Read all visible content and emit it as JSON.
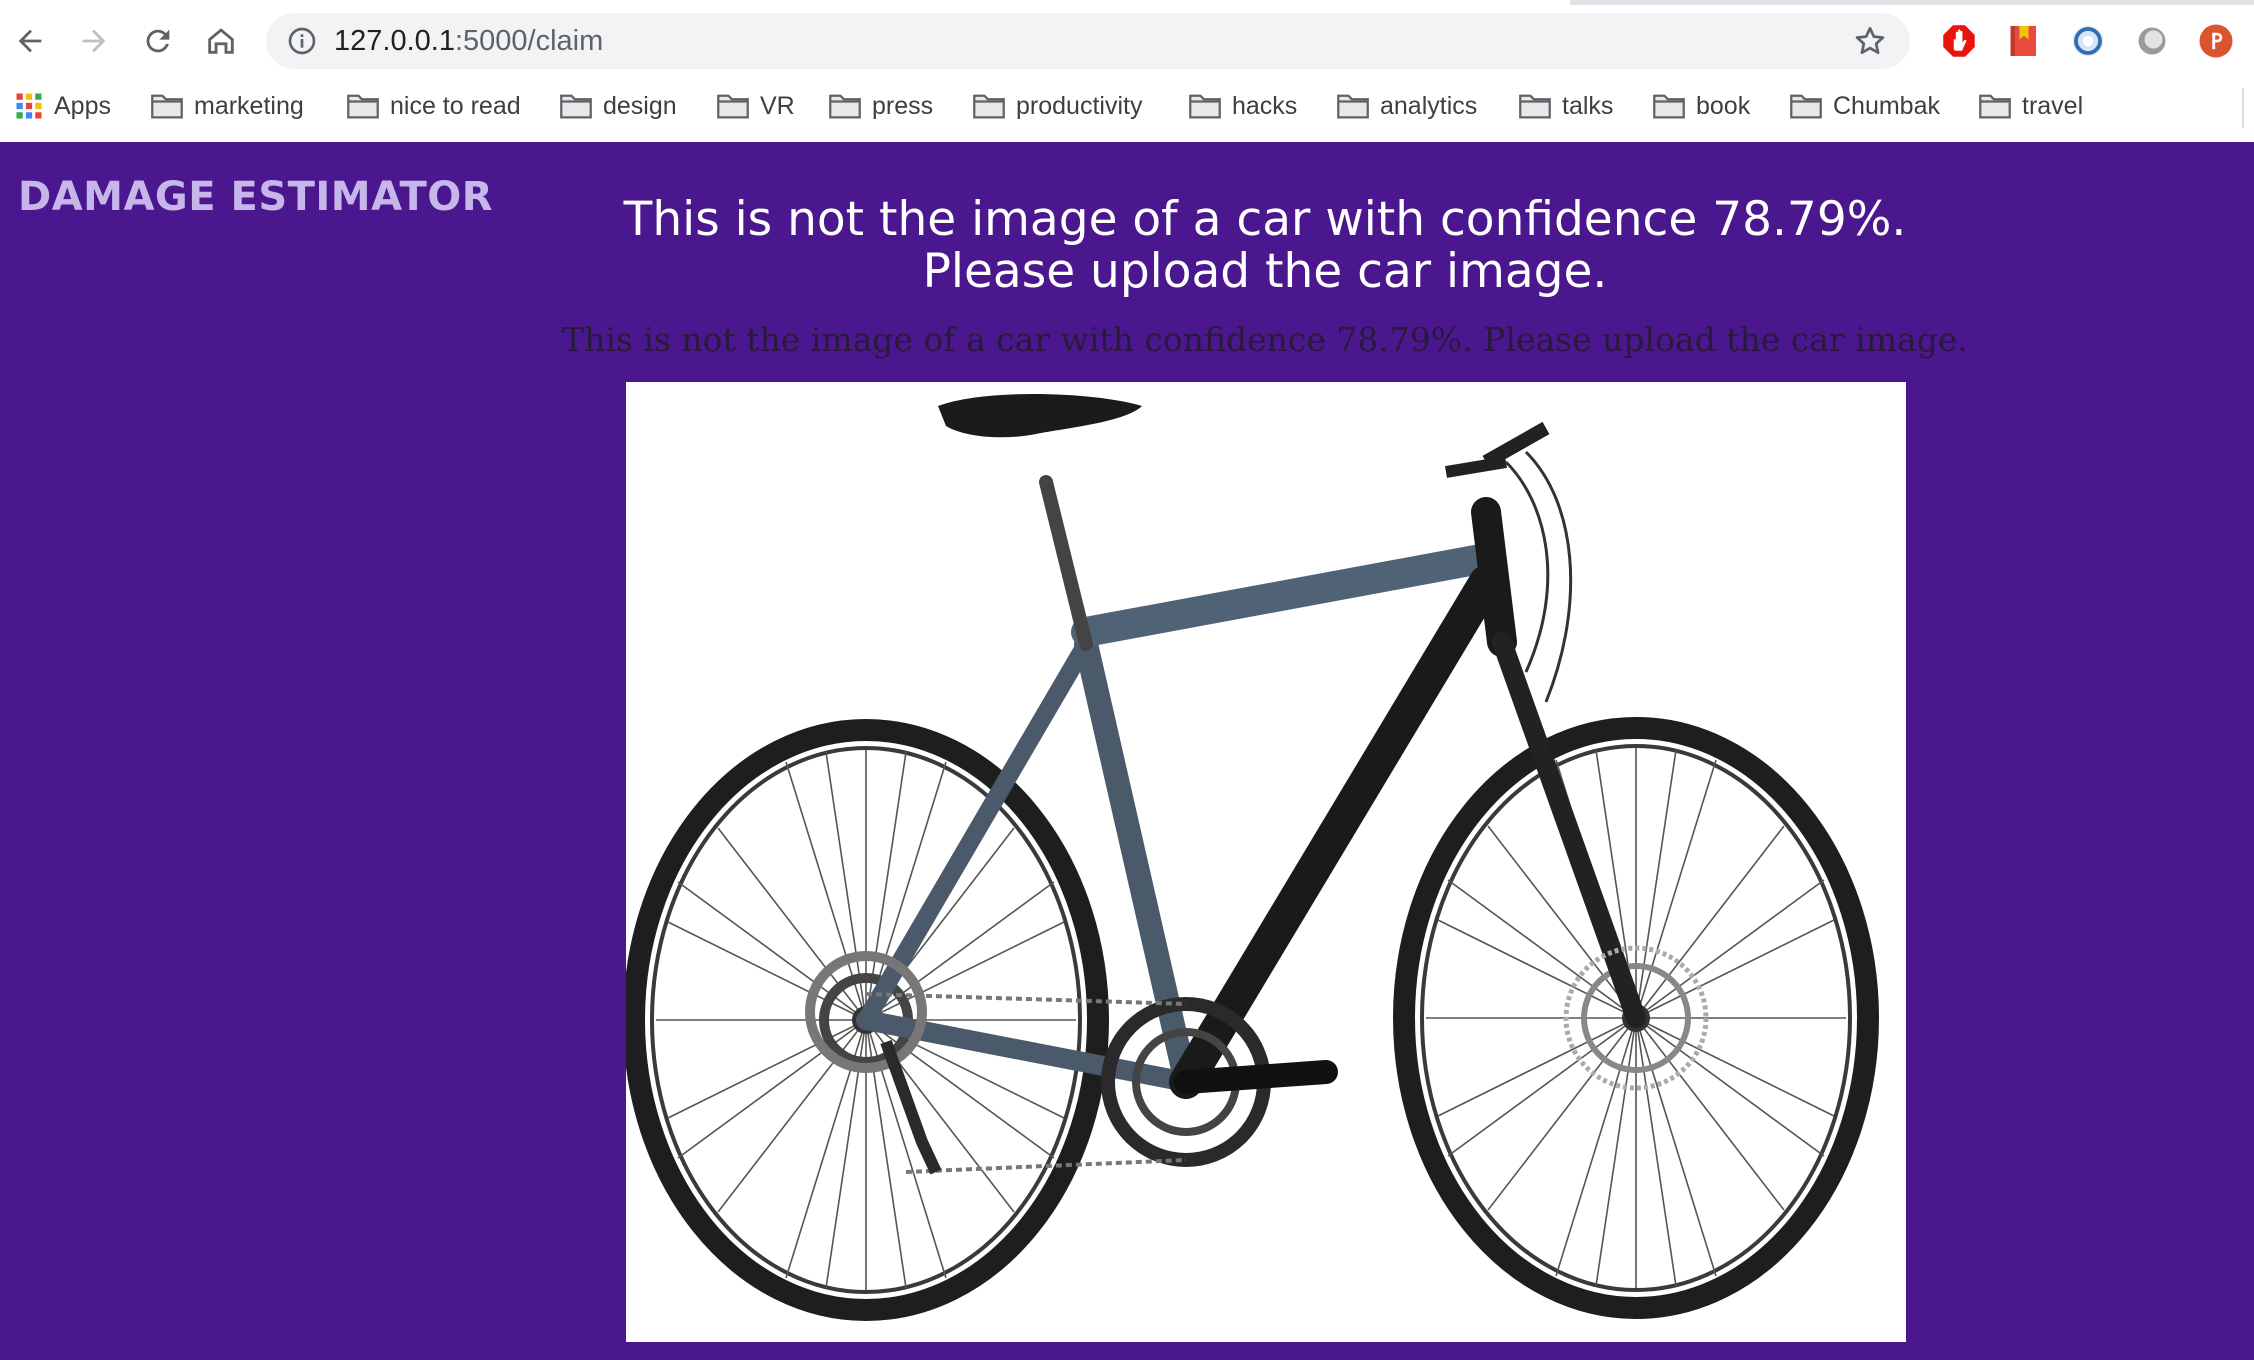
{
  "browser": {
    "url": {
      "host": "127.0.0.1",
      "path": ":5000/claim"
    },
    "bookmarks": [
      {
        "label": "Apps",
        "icon": "apps-grid-icon"
      },
      {
        "label": "marketing",
        "icon": "folder-icon"
      },
      {
        "label": "nice to read",
        "icon": "folder-icon"
      },
      {
        "label": "design",
        "icon": "folder-icon"
      },
      {
        "label": "VR",
        "icon": "folder-icon"
      },
      {
        "label": "press",
        "icon": "folder-icon"
      },
      {
        "label": "productivity",
        "icon": "folder-icon"
      },
      {
        "label": "hacks",
        "icon": "folder-icon"
      },
      {
        "label": "analytics",
        "icon": "folder-icon"
      },
      {
        "label": "talks",
        "icon": "folder-icon"
      },
      {
        "label": "book",
        "icon": "folder-icon"
      },
      {
        "label": "Chumbak",
        "icon": "folder-icon"
      },
      {
        "label": "travel",
        "icon": "folder-icon"
      }
    ],
    "extensions": [
      "adblock-icon",
      "bookmark-manager-icon",
      "sync-icon",
      "circle-extension-icon",
      "product-hunt-icon"
    ]
  },
  "page": {
    "brand": "DAMAGE ESTIMATOR",
    "heading": "This is not the image of a car with confidence 78.79%. Please upload the car image.",
    "subline": "This is not the image of a car with confidence 78.79%. Please upload the car image."
  },
  "colors": {
    "page_background": "#4b178f",
    "brand_text": "#c6b6ea",
    "heading_text": "#ffffff"
  }
}
